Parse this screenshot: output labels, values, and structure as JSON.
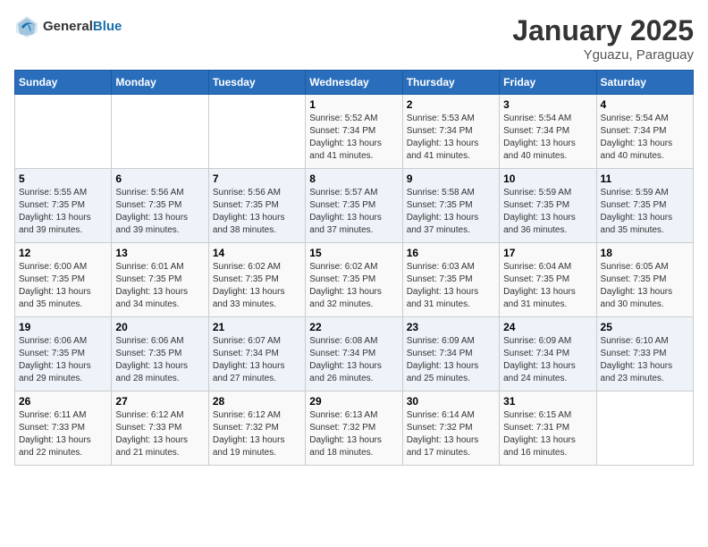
{
  "header": {
    "logo_general": "General",
    "logo_blue": "Blue",
    "month": "January 2025",
    "location": "Yguazu, Paraguay"
  },
  "days_of_week": [
    "Sunday",
    "Monday",
    "Tuesday",
    "Wednesday",
    "Thursday",
    "Friday",
    "Saturday"
  ],
  "weeks": [
    [
      {
        "day": "",
        "info": ""
      },
      {
        "day": "",
        "info": ""
      },
      {
        "day": "",
        "info": ""
      },
      {
        "day": "1",
        "info": "Sunrise: 5:52 AM\nSunset: 7:34 PM\nDaylight: 13 hours\nand 41 minutes."
      },
      {
        "day": "2",
        "info": "Sunrise: 5:53 AM\nSunset: 7:34 PM\nDaylight: 13 hours\nand 41 minutes."
      },
      {
        "day": "3",
        "info": "Sunrise: 5:54 AM\nSunset: 7:34 PM\nDaylight: 13 hours\nand 40 minutes."
      },
      {
        "day": "4",
        "info": "Sunrise: 5:54 AM\nSunset: 7:34 PM\nDaylight: 13 hours\nand 40 minutes."
      }
    ],
    [
      {
        "day": "5",
        "info": "Sunrise: 5:55 AM\nSunset: 7:35 PM\nDaylight: 13 hours\nand 39 minutes."
      },
      {
        "day": "6",
        "info": "Sunrise: 5:56 AM\nSunset: 7:35 PM\nDaylight: 13 hours\nand 39 minutes."
      },
      {
        "day": "7",
        "info": "Sunrise: 5:56 AM\nSunset: 7:35 PM\nDaylight: 13 hours\nand 38 minutes."
      },
      {
        "day": "8",
        "info": "Sunrise: 5:57 AM\nSunset: 7:35 PM\nDaylight: 13 hours\nand 37 minutes."
      },
      {
        "day": "9",
        "info": "Sunrise: 5:58 AM\nSunset: 7:35 PM\nDaylight: 13 hours\nand 37 minutes."
      },
      {
        "day": "10",
        "info": "Sunrise: 5:59 AM\nSunset: 7:35 PM\nDaylight: 13 hours\nand 36 minutes."
      },
      {
        "day": "11",
        "info": "Sunrise: 5:59 AM\nSunset: 7:35 PM\nDaylight: 13 hours\nand 35 minutes."
      }
    ],
    [
      {
        "day": "12",
        "info": "Sunrise: 6:00 AM\nSunset: 7:35 PM\nDaylight: 13 hours\nand 35 minutes."
      },
      {
        "day": "13",
        "info": "Sunrise: 6:01 AM\nSunset: 7:35 PM\nDaylight: 13 hours\nand 34 minutes."
      },
      {
        "day": "14",
        "info": "Sunrise: 6:02 AM\nSunset: 7:35 PM\nDaylight: 13 hours\nand 33 minutes."
      },
      {
        "day": "15",
        "info": "Sunrise: 6:02 AM\nSunset: 7:35 PM\nDaylight: 13 hours\nand 32 minutes."
      },
      {
        "day": "16",
        "info": "Sunrise: 6:03 AM\nSunset: 7:35 PM\nDaylight: 13 hours\nand 31 minutes."
      },
      {
        "day": "17",
        "info": "Sunrise: 6:04 AM\nSunset: 7:35 PM\nDaylight: 13 hours\nand 31 minutes."
      },
      {
        "day": "18",
        "info": "Sunrise: 6:05 AM\nSunset: 7:35 PM\nDaylight: 13 hours\nand 30 minutes."
      }
    ],
    [
      {
        "day": "19",
        "info": "Sunrise: 6:06 AM\nSunset: 7:35 PM\nDaylight: 13 hours\nand 29 minutes."
      },
      {
        "day": "20",
        "info": "Sunrise: 6:06 AM\nSunset: 7:35 PM\nDaylight: 13 hours\nand 28 minutes."
      },
      {
        "day": "21",
        "info": "Sunrise: 6:07 AM\nSunset: 7:34 PM\nDaylight: 13 hours\nand 27 minutes."
      },
      {
        "day": "22",
        "info": "Sunrise: 6:08 AM\nSunset: 7:34 PM\nDaylight: 13 hours\nand 26 minutes."
      },
      {
        "day": "23",
        "info": "Sunrise: 6:09 AM\nSunset: 7:34 PM\nDaylight: 13 hours\nand 25 minutes."
      },
      {
        "day": "24",
        "info": "Sunrise: 6:09 AM\nSunset: 7:34 PM\nDaylight: 13 hours\nand 24 minutes."
      },
      {
        "day": "25",
        "info": "Sunrise: 6:10 AM\nSunset: 7:33 PM\nDaylight: 13 hours\nand 23 minutes."
      }
    ],
    [
      {
        "day": "26",
        "info": "Sunrise: 6:11 AM\nSunset: 7:33 PM\nDaylight: 13 hours\nand 22 minutes."
      },
      {
        "day": "27",
        "info": "Sunrise: 6:12 AM\nSunset: 7:33 PM\nDaylight: 13 hours\nand 21 minutes."
      },
      {
        "day": "28",
        "info": "Sunrise: 6:12 AM\nSunset: 7:32 PM\nDaylight: 13 hours\nand 19 minutes."
      },
      {
        "day": "29",
        "info": "Sunrise: 6:13 AM\nSunset: 7:32 PM\nDaylight: 13 hours\nand 18 minutes."
      },
      {
        "day": "30",
        "info": "Sunrise: 6:14 AM\nSunset: 7:32 PM\nDaylight: 13 hours\nand 17 minutes."
      },
      {
        "day": "31",
        "info": "Sunrise: 6:15 AM\nSunset: 7:31 PM\nDaylight: 13 hours\nand 16 minutes."
      },
      {
        "day": "",
        "info": ""
      }
    ]
  ]
}
